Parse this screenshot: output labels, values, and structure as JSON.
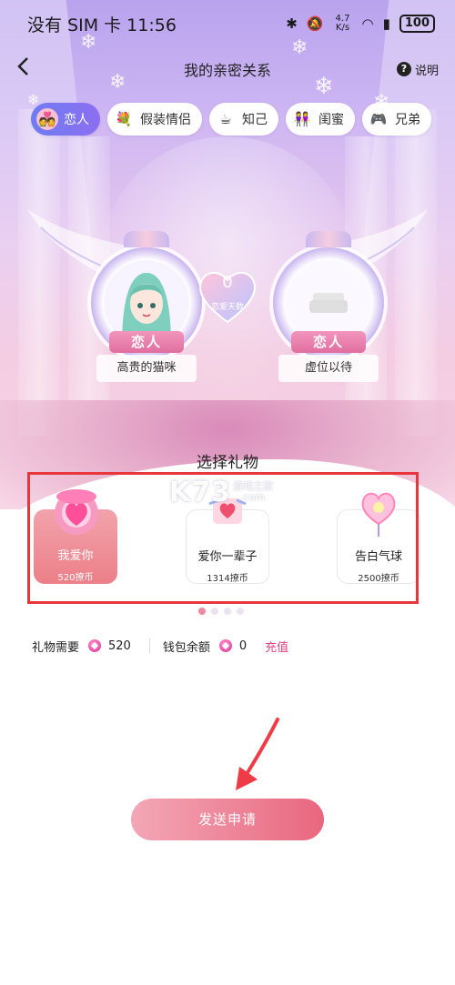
{
  "status_bar": {
    "carrier_time": "没有 SIM 卡 11:56",
    "net_speed": "4.7 K/s",
    "battery": "100"
  },
  "header": {
    "title": "我的亲密关系",
    "help_label": "说明"
  },
  "tabs": [
    {
      "label": "恋人",
      "icon": "lovers-icon",
      "active": true
    },
    {
      "label": "假装情侣",
      "icon": "flower-icon",
      "active": false
    },
    {
      "label": "知己",
      "icon": "teacup-icon",
      "active": false
    },
    {
      "label": "闺蜜",
      "icon": "friends-icon",
      "active": false
    },
    {
      "label": "兄弟",
      "icon": "gamepad-icon",
      "active": false
    }
  ],
  "relation": {
    "left_badge": "恋人",
    "right_badge": "恋人",
    "left_name": "高贵的猫咪",
    "right_name": "虚位以待",
    "love_days": "0",
    "love_days_label": "恋爱天数"
  },
  "gifts": {
    "title": "选择礼物",
    "items": [
      {
        "name": "我爱你",
        "price": "520撩币",
        "selected": true
      },
      {
        "name": "爱你一辈子",
        "price": "1314撩币",
        "selected": false
      },
      {
        "name": "告白气球",
        "price": "2500撩币",
        "selected": false
      }
    ]
  },
  "cost": {
    "need_label": "礼物需要",
    "need_value": "520",
    "balance_label": "钱包余额",
    "balance_value": "0",
    "recharge_label": "充值"
  },
  "submit_label": "发送申请",
  "watermark": {
    "brand": "K73",
    "cn": "游戏之家",
    "domain": ".com"
  },
  "colors": {
    "accent": "#e9677f",
    "active_tab": "#7a76f2",
    "highlight_box": "#e8363d"
  }
}
